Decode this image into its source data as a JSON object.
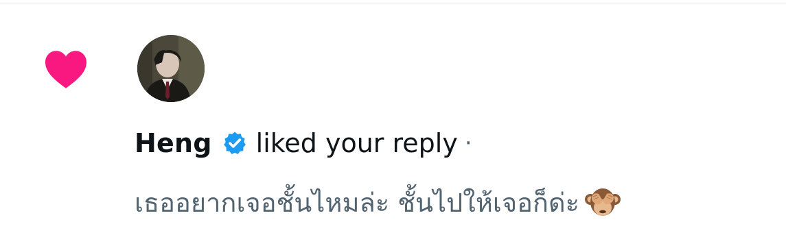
{
  "notification": {
    "user_name": "Heng",
    "action": "liked your reply",
    "separator": "·",
    "reply_text": "เธออยากเจอชั้นไหมล่ะ ชั้นไปให้เจอก็ด่ะ",
    "reply_emoji": "see-no-evil-monkey-icon"
  },
  "icons": {
    "like": "heart-icon",
    "verified": "verified-badge-icon"
  },
  "colors": {
    "heart": "#f91880",
    "verified": "#1d9bf0",
    "primary_text": "#0f1419",
    "secondary_text": "#536471"
  }
}
